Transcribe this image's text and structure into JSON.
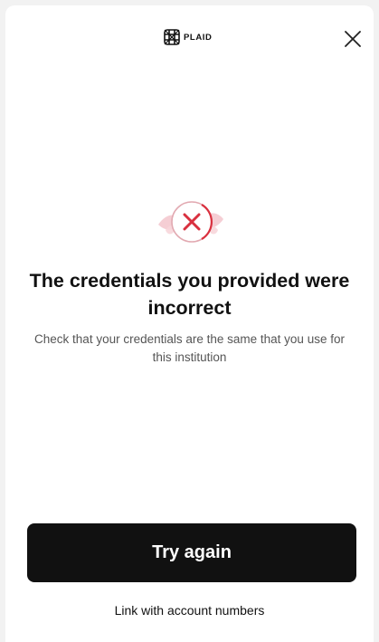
{
  "header": {
    "logo_text": "PLAID",
    "logo_icon": "plaid-logo-icon",
    "close_icon": "close-icon"
  },
  "error": {
    "icon": "error-x-icon",
    "title": "The credentials you provided were incorrect",
    "message": "Check that your credentials are the same that you use for this institution"
  },
  "actions": {
    "primary_label": "Try again",
    "secondary_label": "Link with account numbers"
  },
  "colors": {
    "accent_error": "#d9303f",
    "error_ring": "#e8b4bb",
    "button_bg": "#111111",
    "button_text": "#ffffff",
    "background": "#ffffff"
  }
}
